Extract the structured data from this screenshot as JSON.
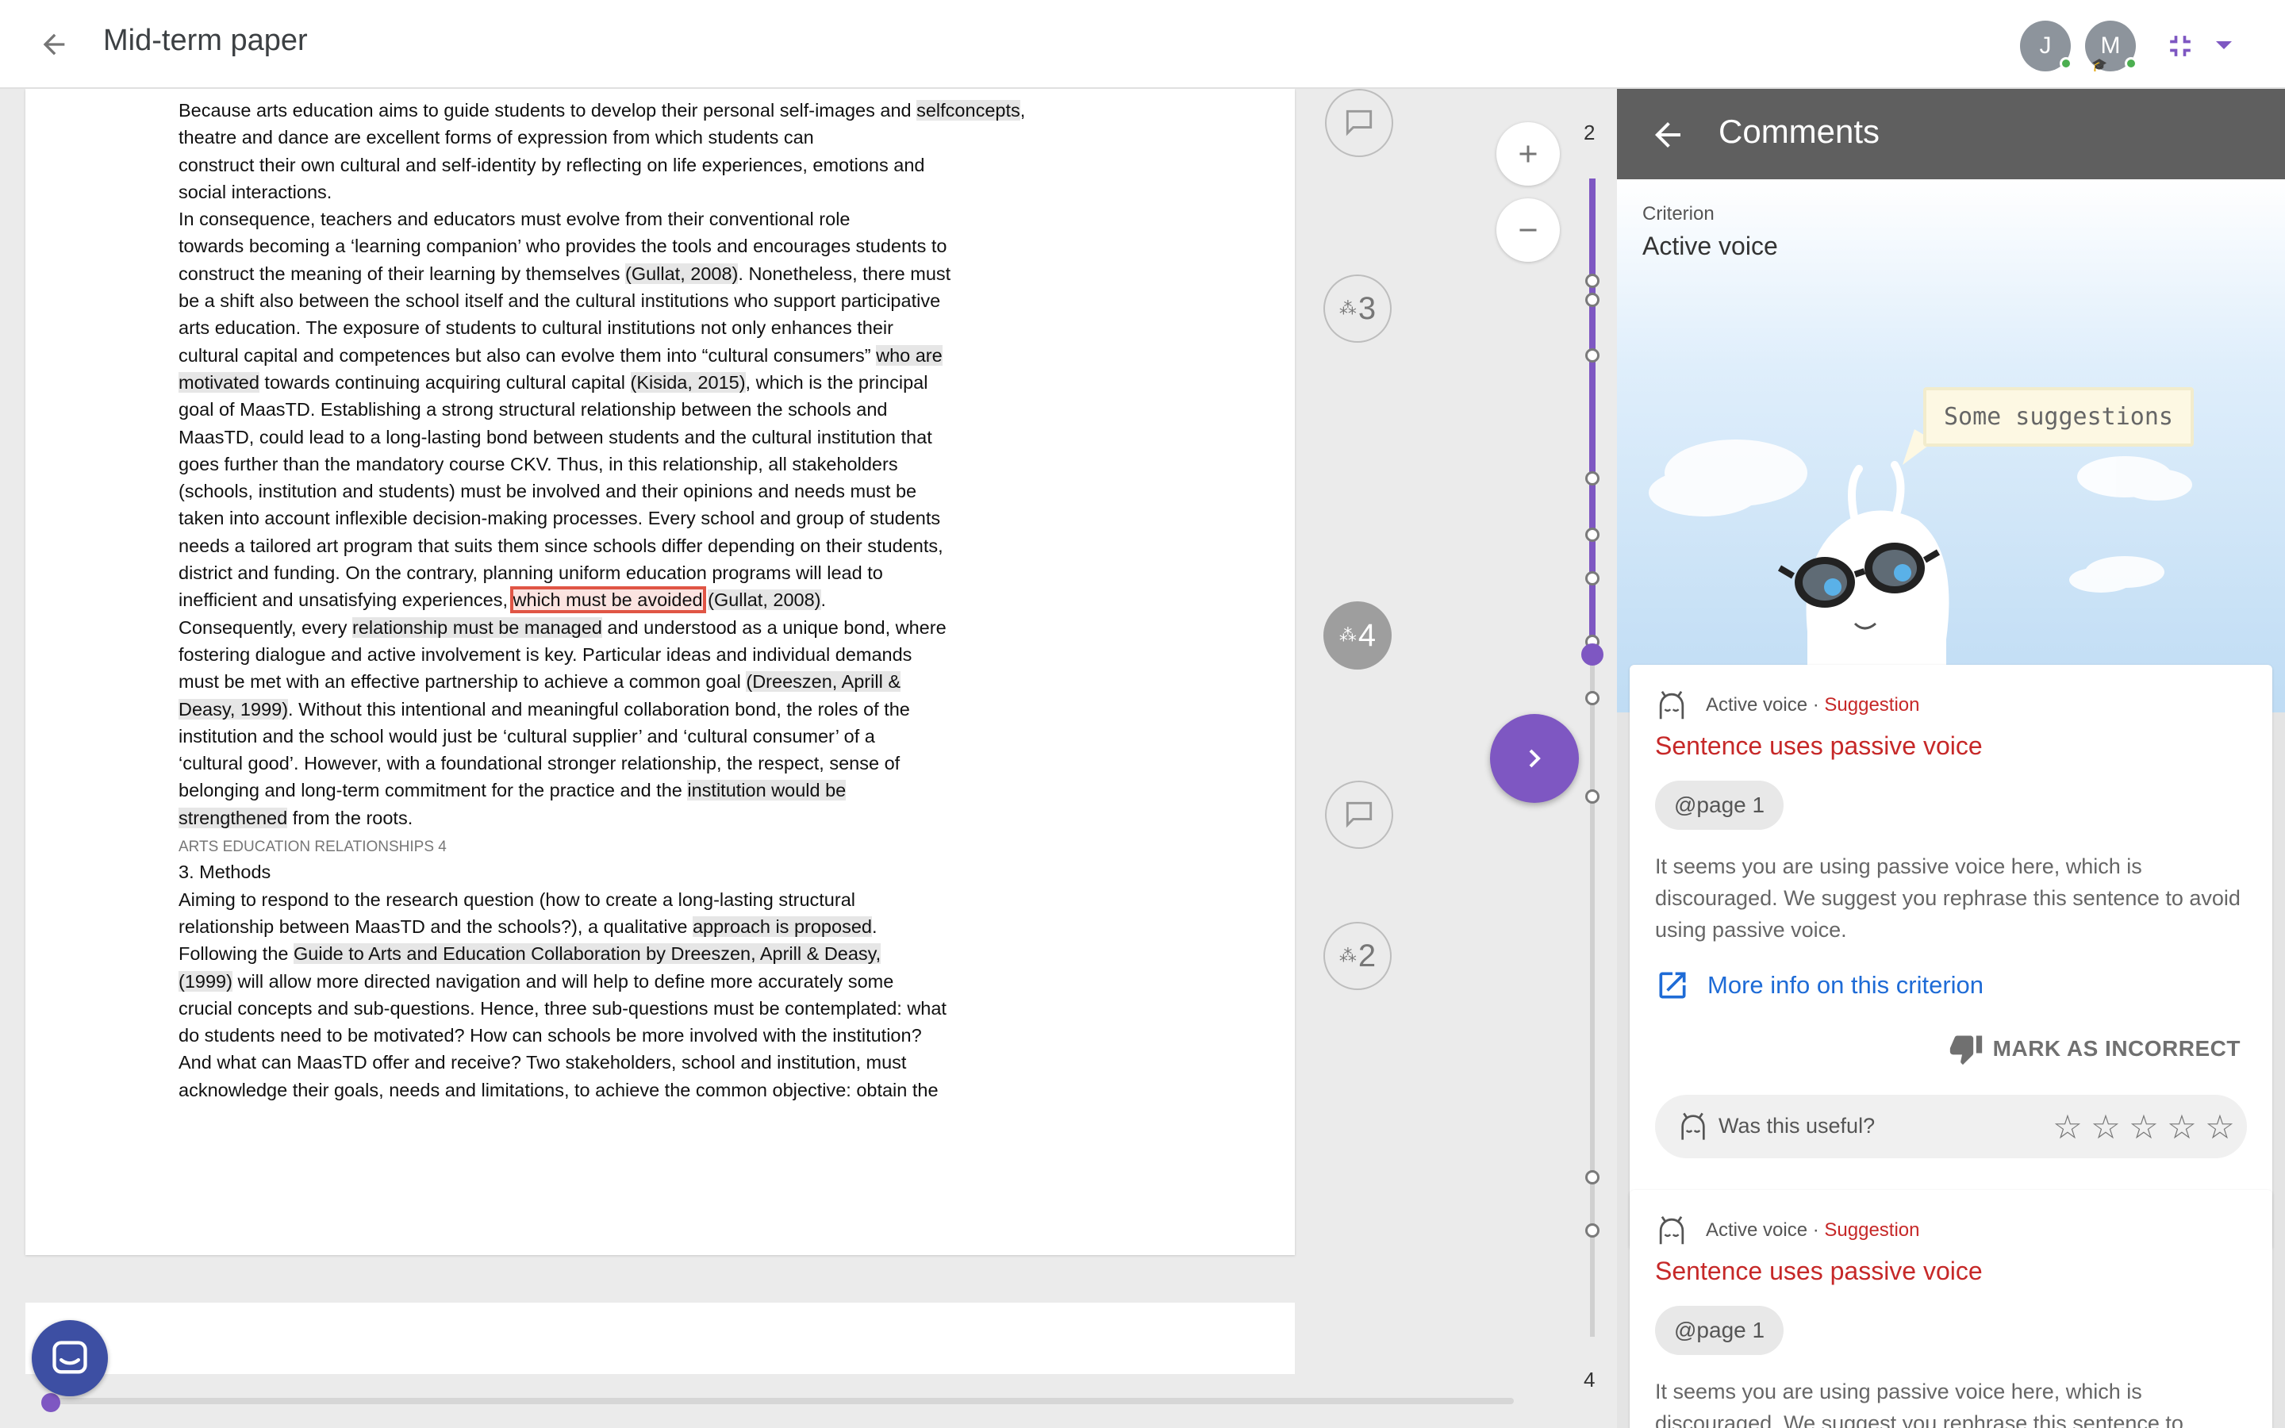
{
  "app": {
    "title": "Mid-term paper",
    "avatars": [
      {
        "initial": "J",
        "status": "online"
      },
      {
        "initial": "M",
        "status": "online"
      }
    ]
  },
  "document": {
    "lines": [
      [
        {
          "t": "Because arts education aims to guide students to develop their personal self-images and "
        },
        {
          "t": "selfconcepts",
          "h": 1
        },
        {
          "t": ","
        }
      ],
      [
        {
          "t": "theatre and dance are excellent forms of expression from which students can"
        }
      ],
      [
        {
          "t": "construct their own cultural and self-identity by reflecting on life experiences, emotions and"
        }
      ],
      [
        {
          "t": "social interactions."
        }
      ],
      [
        {
          "t": "In consequence, teachers and educators must evolve from their conventional role"
        }
      ],
      [
        {
          "t": "towards becoming a ‘learning companion’ who provides the tools and encourages students to"
        }
      ],
      [
        {
          "t": "construct the meaning of their learning by themselves "
        },
        {
          "t": "(Gullat, 2008)",
          "h": 1
        },
        {
          "t": ". Nonetheless, there must"
        }
      ],
      [
        {
          "t": "be a shift also between the school itself and the cultural institutions who support participative"
        }
      ],
      [
        {
          "t": "arts education. The exposure of students to cultural institutions not only enhances their"
        }
      ],
      [
        {
          "t": "cultural capital and competences but also can evolve them into “cultural consumers” "
        },
        {
          "t": "who are",
          "h": 1
        }
      ],
      [
        {
          "t": "motivated",
          "h": 1
        },
        {
          "t": " towards continuing acquiring cultural capital "
        },
        {
          "t": "(Kisida, 2015)",
          "h": 1
        },
        {
          "t": ", which is the principal"
        }
      ],
      [
        {
          "t": "goal of MaasTD. Establishing a strong structural relationship between the schools and"
        }
      ],
      [
        {
          "t": "MaasTD, could lead to a long-lasting bond between students and the cultural institution that"
        }
      ],
      [
        {
          "t": "goes further than the mandatory course CKV. Thus, in this relationship, all stakeholders"
        }
      ],
      [
        {
          "t": "(schools, institution and students) must be involved and their opinions and needs must be"
        }
      ],
      [
        {
          "t": "taken into account inflexible decision-making processes. Every school and group of students"
        }
      ],
      [
        {
          "t": "needs a tailored art program that suits them since schools differ depending on their students,"
        }
      ],
      [
        {
          "t": "district and funding. On the contrary, planning uniform education programs will lead to"
        }
      ],
      [
        {
          "t": "inefficient and unsatisfying experiences, "
        },
        {
          "t": "which must be avoided",
          "h": 2
        },
        {
          "t": " "
        },
        {
          "t": "(Gullat, 2008)",
          "h": 1
        },
        {
          "t": "."
        }
      ],
      [
        {
          "t": "Consequently, every "
        },
        {
          "t": "relationship must be managed",
          "h": 1
        },
        {
          "t": " and understood as a unique bond, where"
        }
      ],
      [
        {
          "t": "fostering dialogue and active involvement is key. Particular ideas and individual demands"
        }
      ],
      [
        {
          "t": "must be met with an effective partnership to achieve a common goal "
        },
        {
          "t": "(Dreeszen, Aprill &",
          "h": 1
        }
      ],
      [
        {
          "t": "Deasy, 1999)",
          "h": 1
        },
        {
          "t": ". Without this intentional and meaningful collaboration bond, the roles of the"
        }
      ],
      [
        {
          "t": "institution and the school would just be ‘cultural supplier’ and ‘cultural consumer’ of a"
        }
      ],
      [
        {
          "t": "‘cultural good’. However, with a foundational stronger relationship, the respect, sense of"
        }
      ],
      [
        {
          "t": "belonging and long-term commitment for the practice and the "
        },
        {
          "t": "institution would be",
          "h": 1
        }
      ],
      [
        {
          "t": "strengthened",
          "h": 1
        },
        {
          "t": " from the roots."
        }
      ],
      [
        {
          "t": "ARTS EDUCATION RELATIONSHIPS 4",
          "s": 1
        }
      ],
      [
        {
          "t": "3. Methods"
        }
      ],
      [
        {
          "t": "Aiming to respond to the research question (how to create a long-lasting structural"
        }
      ],
      [
        {
          "t": "relationship between MaasTD and the schools?), a qualitative "
        },
        {
          "t": "approach is proposed",
          "h": 1
        },
        {
          "t": "."
        }
      ],
      [
        {
          "t": "Following the "
        },
        {
          "t": "Guide to Arts and Education Collaboration by Dreeszen, Aprill & Deasy,",
          "h": 1
        }
      ],
      [
        {
          "t": "(1999)",
          "h": 1
        },
        {
          "t": " will allow more directed navigation and will help to define more accurately some"
        }
      ],
      [
        {
          "t": "crucial concepts and sub-questions. Hence, three sub-questions must be contemplated: what"
        }
      ],
      [
        {
          "t": "do students need to be motivated? How can schools be more involved with the institution?"
        }
      ],
      [
        {
          "t": "And what can MaasTD offer and receive? Two stakeholders, school and institution, must"
        }
      ],
      [
        {
          "t": "acknowledge their goals, needs and limitations, to achieve the common objective: obtain the"
        }
      ]
    ]
  },
  "rail": {
    "groups": [
      {
        "count": "3"
      },
      {
        "count": "4"
      },
      {
        "count": "2"
      }
    ]
  },
  "timeline": {
    "start_page": "2",
    "end_page": "4"
  },
  "panel": {
    "title": "Comments",
    "criterion_label": "Criterion",
    "criterion_name": "Active voice",
    "mascot_speech": "Some suggestions",
    "cards": [
      {
        "category": "Active voice",
        "separator": " · ",
        "type": "Suggestion",
        "title": "Sentence uses passive voice",
        "page": "@page 1",
        "body": "It seems you are using passive voice here, which is discouraged. We suggest you rephrase this sentence to avoid using passive voice.",
        "more_info": "More info on this criterion",
        "mark_incorrect": "MARK AS INCORRECT",
        "useful_prompt": "Was this useful?"
      },
      {
        "category": "Active voice",
        "separator": " · ",
        "type": "Suggestion",
        "title": "Sentence uses passive voice",
        "page": "@page 1",
        "body": "It seems you are using passive voice here, which is discouraged. We suggest you rephrase this sentence to"
      }
    ]
  },
  "colors": {
    "accent": "#7e57c2",
    "suggestion_red": "#c62828",
    "link_blue": "#1e6bd6",
    "header_gray": "#5f5f5f"
  }
}
